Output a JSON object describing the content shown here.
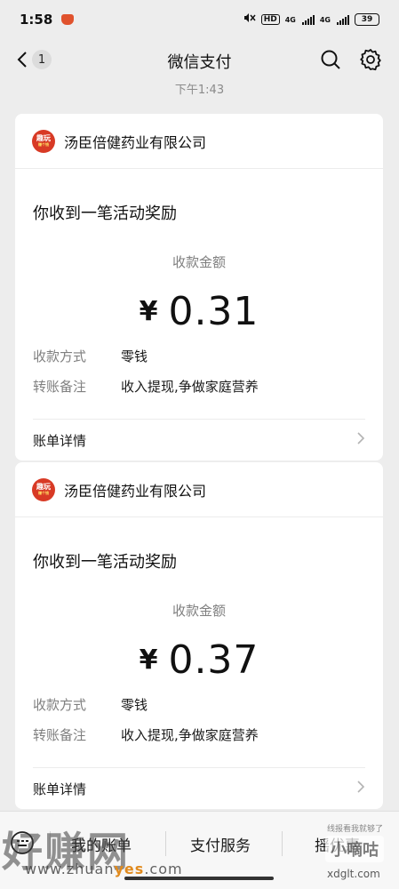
{
  "status_bar": {
    "time": "1:58",
    "network_1": "4G",
    "network_2": "4G",
    "hd": "HD",
    "battery": "39"
  },
  "nav": {
    "title": "微信支付",
    "unread_badge": "1"
  },
  "timestamp": "下午1:43",
  "messages": [
    {
      "merchant_logo_text": "趣玩",
      "merchant_logo_sub": "赚个钱",
      "merchant": "汤臣倍健药业有限公司",
      "heading": "你收到一笔活动奖励",
      "amount_label": "收款金额",
      "currency": "¥",
      "amount": "0.31",
      "method_label": "收款方式",
      "method_value": "零钱",
      "note_label": "转账备注",
      "note_value": "收入提现,争做家庭营养",
      "details_link": "账单详情"
    },
    {
      "merchant_logo_text": "趣玩",
      "merchant_logo_sub": "赚个钱",
      "merchant": "汤臣倍健药业有限公司",
      "heading": "你收到一笔活动奖励",
      "amount_label": "收款金额",
      "currency": "¥",
      "amount": "0.37",
      "method_label": "收款方式",
      "method_value": "零钱",
      "note_label": "转账备注",
      "note_value": "收入提现,争做家庭营养",
      "details_link": "账单详情"
    }
  ],
  "bottom_tabs": [
    "我的账单",
    "支付服务",
    "摇优惠"
  ],
  "watermarks": {
    "left_brand": "好赚网",
    "left_url_prefix": "www.zhuan",
    "left_url_highlight": "yes",
    "left_url_suffix": ".com",
    "right_brand": "小嘀咕",
    "right_small": "线报看我就够了",
    "right_domain": "xdglt.com"
  },
  "colors": {
    "background": "#ededed",
    "card": "#ffffff",
    "logo_red": "#d83a25"
  }
}
